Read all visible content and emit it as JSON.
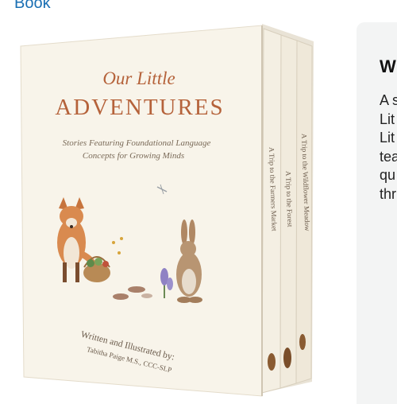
{
  "nav": {
    "link_label": "Book"
  },
  "book": {
    "title_line1": "Our Little",
    "title_line2": "ADVENTURES",
    "subtitle_line1": "Stories Featuring Foundational Language",
    "subtitle_line2": "Concepts for Growing Minds",
    "author_line1": "Written and Illustrated by:",
    "author_line2": "Tabitha Paige M.S., CCC-SLP",
    "spines": [
      "A Trip to the Farmers Market",
      "A Trip to the Forest",
      "A Trip to the Wildflower Meadow"
    ]
  },
  "side_panel": {
    "title_fragment": "W",
    "text_fragments": [
      "A s",
      "Lit",
      "Lit",
      "tea",
      "qu",
      "thr"
    ]
  },
  "colors": {
    "link": "#1a6fb3",
    "title_accent": "#b5623a",
    "cover_bg": "#f8f4ea",
    "panel_bg": "#f3f4f4"
  }
}
